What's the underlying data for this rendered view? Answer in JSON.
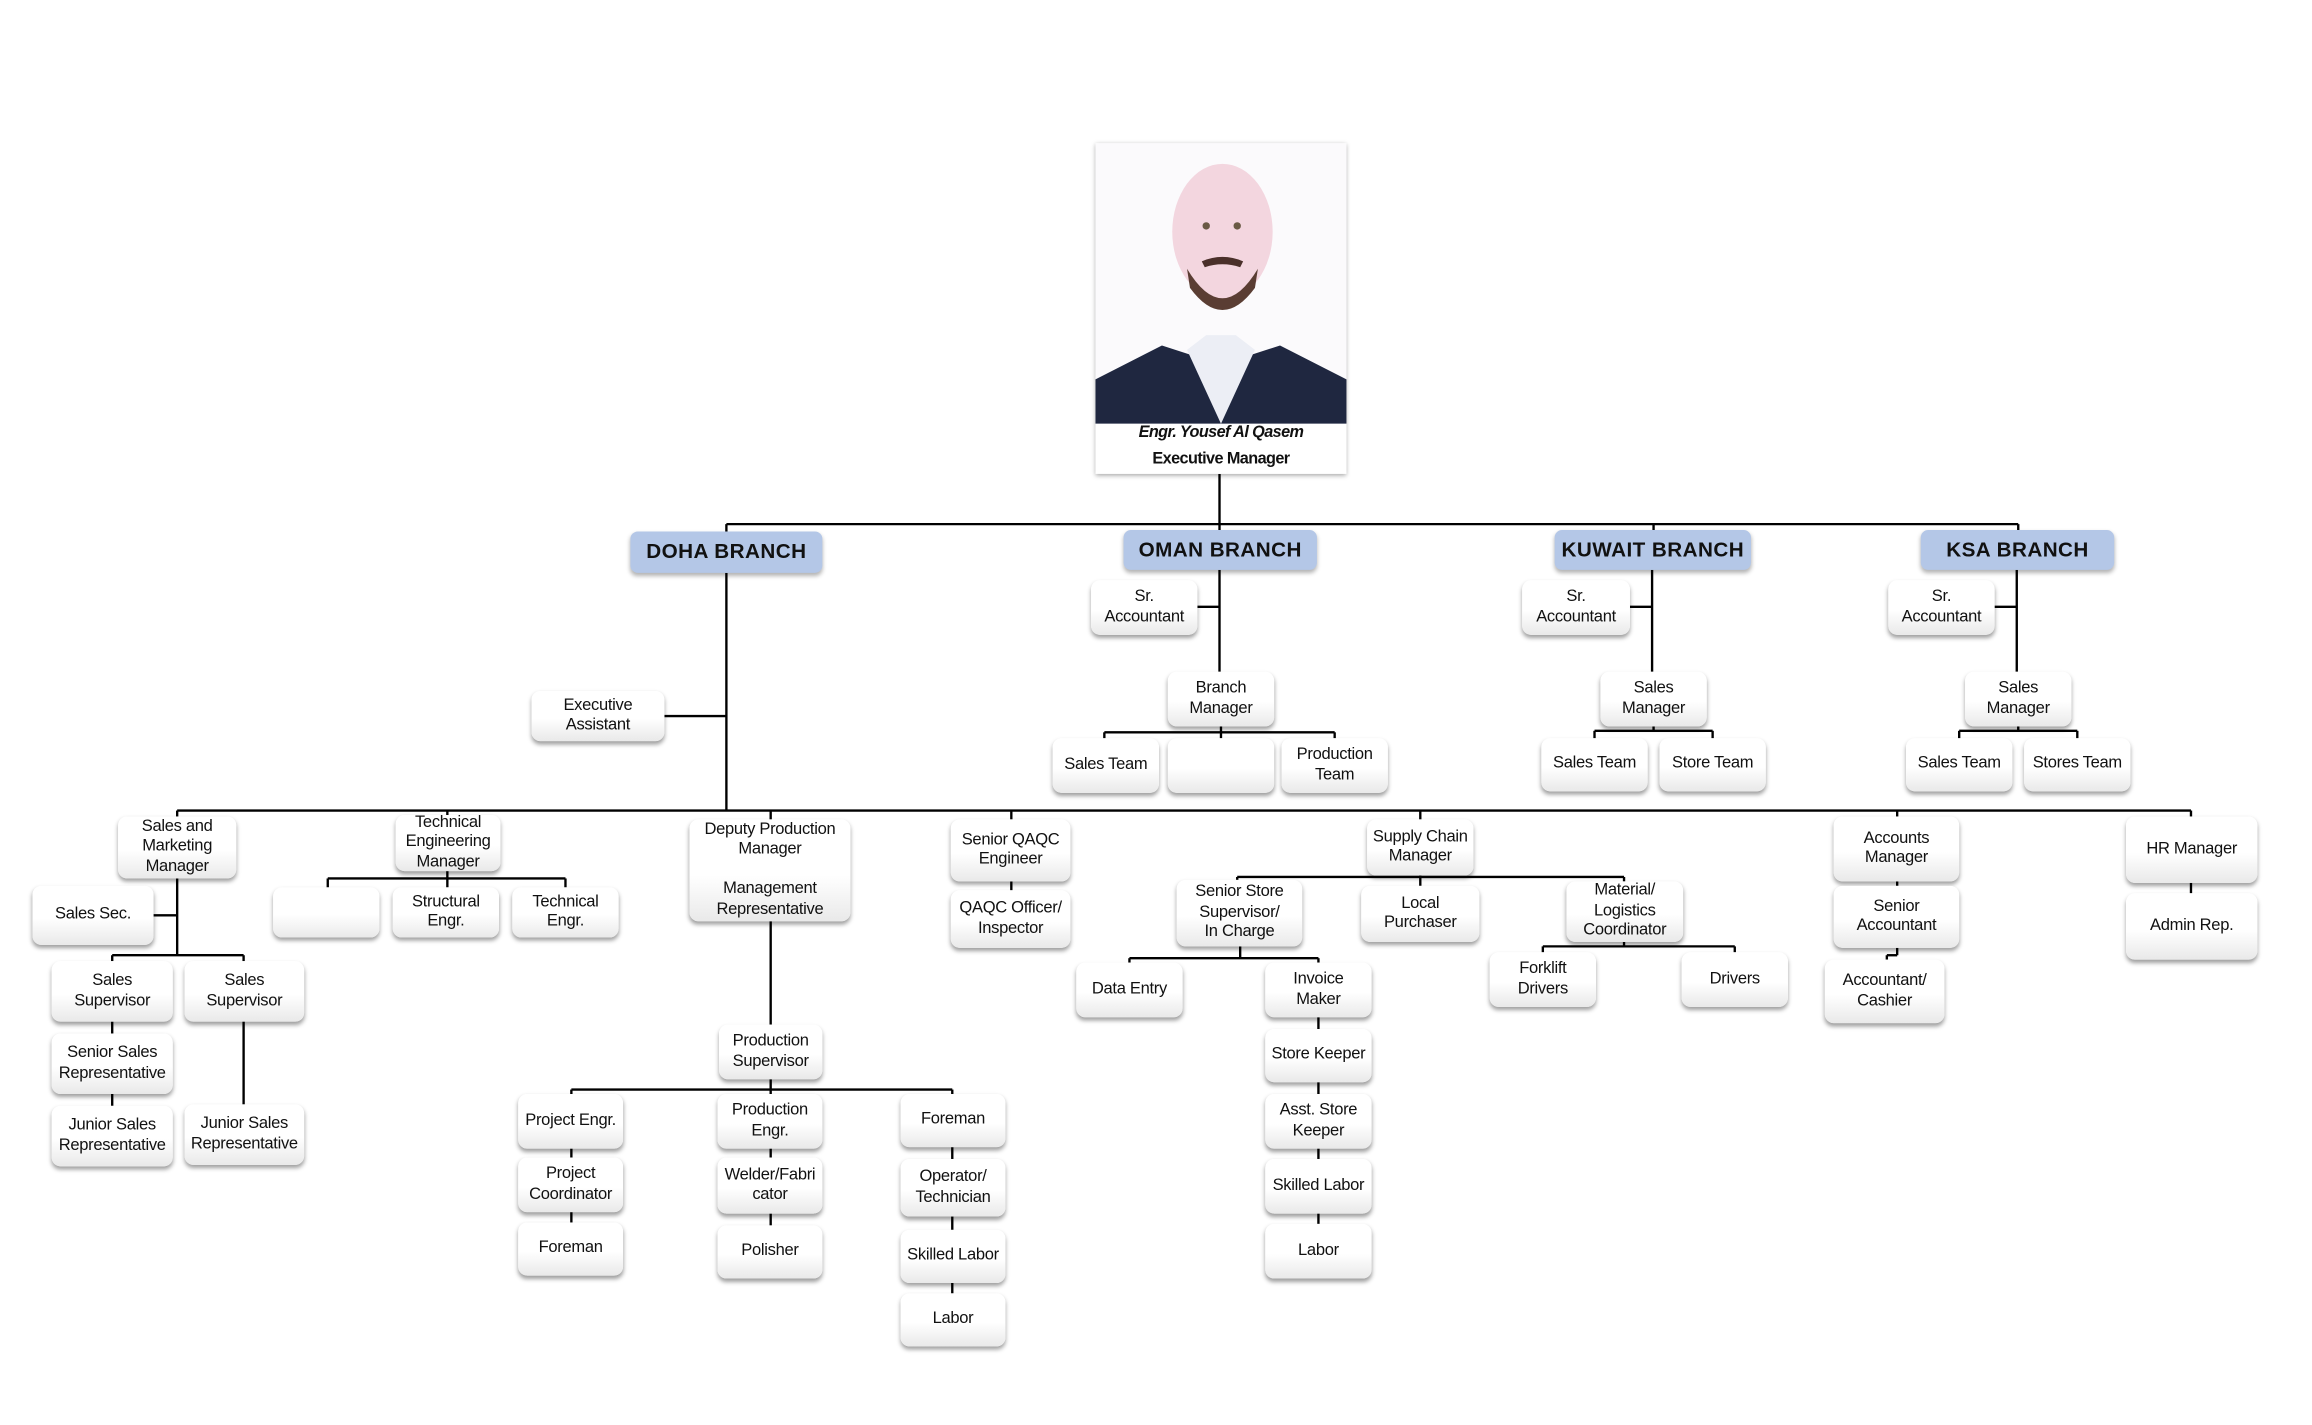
{
  "executive": {
    "name": "Engr. Yousef Al Qasem",
    "title": "Executive Manager"
  },
  "branches": {
    "doha": {
      "label": "DOHA BRANCH",
      "executive_assistant": "Executive\nAssistant",
      "sales": {
        "manager": "Sales and\nMarketing\nManager",
        "secretary": "Sales Sec.",
        "supervisor_1": "Sales\nSupervisor",
        "supervisor_2": "Sales\nSupervisor",
        "senior_rep": "Senior Sales\nRepresentative",
        "junior_rep_1": "Junior Sales\nRepresentative",
        "junior_rep_2": "Junior Sales\nRepresentative"
      },
      "technical": {
        "manager": "Technical\nEngineering\nManager",
        "blank": "",
        "structural": "Structural\nEngr.",
        "technical_engr": "Technical\nEngr."
      },
      "production": {
        "deputy": "Deputy Production\nManager\n\nManagement\nRepresentative",
        "supervisor": "Production\nSupervisor",
        "project_engr": "Project Engr.",
        "project_coordinator": "Project\nCoordinator",
        "foreman_1": "Foreman",
        "production_engr": "Production\nEngr.",
        "welder": "Welder/Fabri\ncator",
        "polisher": "Polisher",
        "foreman_2": "Foreman",
        "operator": "Operator/\nTechnician",
        "skilled_labor": "Skilled Labor",
        "labor": "Labor"
      },
      "qaqc": {
        "engineer": "Senior QAQC\nEngineer",
        "officer": "QAQC Officer/\nInspector"
      },
      "supply_chain": {
        "manager": "Supply Chain\nManager",
        "store_supervisor": "Senior Store\nSupervisor/\nIn Charge",
        "local_purchaser": "Local\nPurchaser",
        "logistics": "Material/\nLogistics\nCoordinator",
        "data_entry": "Data Entry",
        "invoice_maker": "Invoice\nMaker",
        "store_keeper": "Store Keeper",
        "asst_store_keeper": "Asst. Store\nKeeper",
        "skilled_labor": "Skilled Labor",
        "labor": "Labor",
        "forklift": "Forklift\nDrivers",
        "drivers": "Drivers"
      },
      "accounts": {
        "manager": "Accounts\nManager",
        "senior": "Senior\nAccountant",
        "cashier": "Accountant/\nCashier"
      },
      "hr": {
        "manager": "HR Manager",
        "admin": "Admin Rep."
      }
    },
    "oman": {
      "label": "OMAN BRANCH",
      "sr_accountant": "Sr.\nAccountant",
      "branch_manager": "Branch\nManager",
      "sales_team": "Sales Team",
      "blank": "",
      "production_team": "Production\nTeam"
    },
    "kuwait": {
      "label": "KUWAIT BRANCH",
      "sr_accountant": "Sr.\nAccountant",
      "sales_manager": "Sales\nManager",
      "sales_team": "Sales Team",
      "store_team": "Store Team"
    },
    "ksa": {
      "label": "KSA BRANCH",
      "sr_accountant": "Sr.\nAccountant",
      "sales_manager": "Sales\nManager",
      "sales_team": "Sales Team",
      "stores_team": "Stores Team"
    }
  },
  "colors": {
    "branch_header": "#b4c7e7",
    "connector": "#000000",
    "box": "#ffffff"
  }
}
